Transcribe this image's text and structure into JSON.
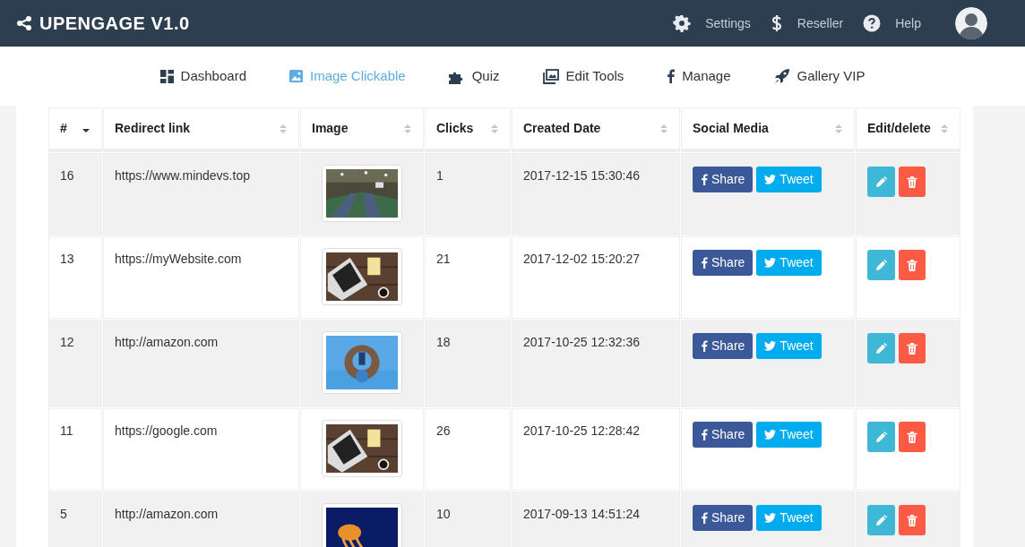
{
  "brand": {
    "title": "UPENGAGE V1.0"
  },
  "top_links": [
    {
      "label": "Settings"
    },
    {
      "label": "Reseller"
    },
    {
      "label": "Help"
    }
  ],
  "nav": [
    {
      "label": "Dashboard",
      "selected": false
    },
    {
      "label": "Image Clickable",
      "selected": true
    },
    {
      "label": "Quiz",
      "selected": false
    },
    {
      "label": "Edit Tools",
      "selected": false
    },
    {
      "label": "Manage",
      "selected": false
    },
    {
      "label": "Gallery VIP",
      "selected": false
    }
  ],
  "table": {
    "columns": [
      {
        "label": "#",
        "sorted": true
      },
      {
        "label": "Redirect link",
        "sorted": false
      },
      {
        "label": "Image",
        "sorted": false
      },
      {
        "label": "Clicks",
        "sorted": false
      },
      {
        "label": "Created Date",
        "sorted": false
      },
      {
        "label": "Social Media",
        "sorted": false
      },
      {
        "label": "Edit/delete",
        "sorted": false
      }
    ],
    "rows": [
      {
        "id": "16",
        "link": "https://www.mindevs.top",
        "clicks": "1",
        "created": "2017-12-15 15:30:46",
        "share": "Share",
        "tweet": "Tweet"
      },
      {
        "id": "13",
        "link": "https://myWebsite.com",
        "clicks": "21",
        "created": "2017-12-02 15:20:27",
        "share": "Share",
        "tweet": "Tweet"
      },
      {
        "id": "12",
        "link": "http://amazon.com",
        "clicks": "18",
        "created": "2017-10-25 12:32:36",
        "share": "Share",
        "tweet": "Tweet"
      },
      {
        "id": "11",
        "link": "https://google.com",
        "clicks": "26",
        "created": "2017-10-25 12:28:42",
        "share": "Share",
        "tweet": "Tweet"
      },
      {
        "id": "5",
        "link": "http://amazon.com",
        "clicks": "10",
        "created": "2017-09-13 14:51:24",
        "share": "Share",
        "tweet": "Tweet"
      }
    ]
  }
}
